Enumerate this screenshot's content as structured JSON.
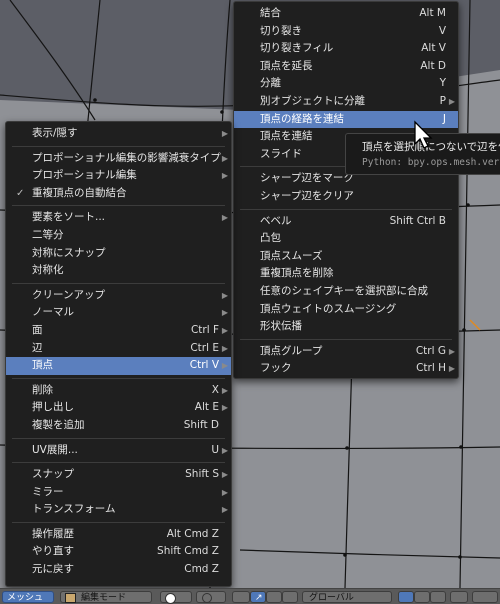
{
  "left_menu": {
    "items": [
      {
        "label": "表示/隠す",
        "shortcut": "",
        "submenu": true
      },
      {
        "sep": true
      },
      {
        "label": "プロポーショナル編集の影響減衰タイプ",
        "shortcut": "",
        "submenu": true
      },
      {
        "label": "プロポーショナル編集",
        "shortcut": "",
        "submenu": true
      },
      {
        "label": "重複頂点の自動結合",
        "shortcut": "",
        "check": true
      },
      {
        "sep": true
      },
      {
        "label": "要素をソート...",
        "shortcut": "",
        "submenu": true
      },
      {
        "label": "二等分",
        "shortcut": ""
      },
      {
        "label": "対称にスナップ",
        "shortcut": ""
      },
      {
        "label": "対称化",
        "shortcut": ""
      },
      {
        "sep": true
      },
      {
        "label": "クリーンアップ",
        "shortcut": "",
        "submenu": true
      },
      {
        "label": "ノーマル",
        "shortcut": "",
        "submenu": true
      },
      {
        "label": "面",
        "shortcut": "Ctrl F",
        "submenu": true
      },
      {
        "label": "辺",
        "shortcut": "Ctrl E",
        "submenu": true
      },
      {
        "label": "頂点",
        "shortcut": "Ctrl V",
        "submenu": true,
        "highlight": true
      },
      {
        "sep": true
      },
      {
        "label": "削除",
        "shortcut": "X",
        "submenu": true
      },
      {
        "label": "押し出し",
        "shortcut": "Alt E",
        "submenu": true
      },
      {
        "label": "複製を追加",
        "shortcut": "Shift D"
      },
      {
        "sep": true
      },
      {
        "label": "UV展開...",
        "shortcut": "U",
        "submenu": true
      },
      {
        "sep": true
      },
      {
        "label": "スナップ",
        "shortcut": "Shift S",
        "submenu": true
      },
      {
        "label": "ミラー",
        "shortcut": "",
        "submenu": true
      },
      {
        "label": "トランスフォーム",
        "shortcut": "",
        "submenu": true
      },
      {
        "sep": true
      },
      {
        "label": "操作履歴",
        "shortcut": "Alt Cmd Z"
      },
      {
        "label": "やり直す",
        "shortcut": "Shift Cmd Z"
      },
      {
        "label": "元に戻す",
        "shortcut": "Cmd Z"
      }
    ]
  },
  "right_menu": {
    "items": [
      {
        "label": "結合",
        "shortcut": "Alt M"
      },
      {
        "label": "切り裂き",
        "shortcut": "V"
      },
      {
        "label": "切り裂きフィル",
        "shortcut": "Alt V"
      },
      {
        "label": "頂点を延長",
        "shortcut": "Alt D"
      },
      {
        "label": "分離",
        "shortcut": "Y"
      },
      {
        "label": "別オブジェクトに分離",
        "shortcut": "P",
        "submenu": true
      },
      {
        "label": "頂点の経路を連結",
        "shortcut": "J",
        "highlight": true
      },
      {
        "label": "頂点を連結",
        "shortcut": ""
      },
      {
        "label": "スライド",
        "shortcut": ""
      },
      {
        "sep": true
      },
      {
        "label": "シャープ辺をマーク",
        "shortcut": ""
      },
      {
        "label": "シャープ辺をクリア",
        "shortcut": ""
      },
      {
        "sep": true
      },
      {
        "label": "ベベル",
        "shortcut": "Shift Ctrl B"
      },
      {
        "label": "凸包",
        "shortcut": ""
      },
      {
        "label": "頂点スムーズ",
        "shortcut": ""
      },
      {
        "label": "重複頂点を削除",
        "shortcut": ""
      },
      {
        "label": "任意のシェイプキーを選択部に合成",
        "shortcut": ""
      },
      {
        "label": "頂点ウェイトのスムージング",
        "shortcut": ""
      },
      {
        "label": "形状伝播",
        "shortcut": ""
      },
      {
        "sep": true
      },
      {
        "label": "頂点グループ",
        "shortcut": "Ctrl G",
        "submenu": true
      },
      {
        "label": "フック",
        "shortcut": "Ctrl H",
        "submenu": true
      }
    ]
  },
  "tooltip": {
    "line1": "頂点を選択順につないで辺を作り",
    "line2": "Python: bpy.ops.mesh.vert"
  },
  "header": {
    "menu_label": "メッシュ",
    "mode_label": "編集モード",
    "orientation_label": "グローバル"
  },
  "colors": {
    "menu_bg": "#1f1f1f",
    "highlight": "#5b7fbe",
    "viewport": "#8f9196"
  }
}
